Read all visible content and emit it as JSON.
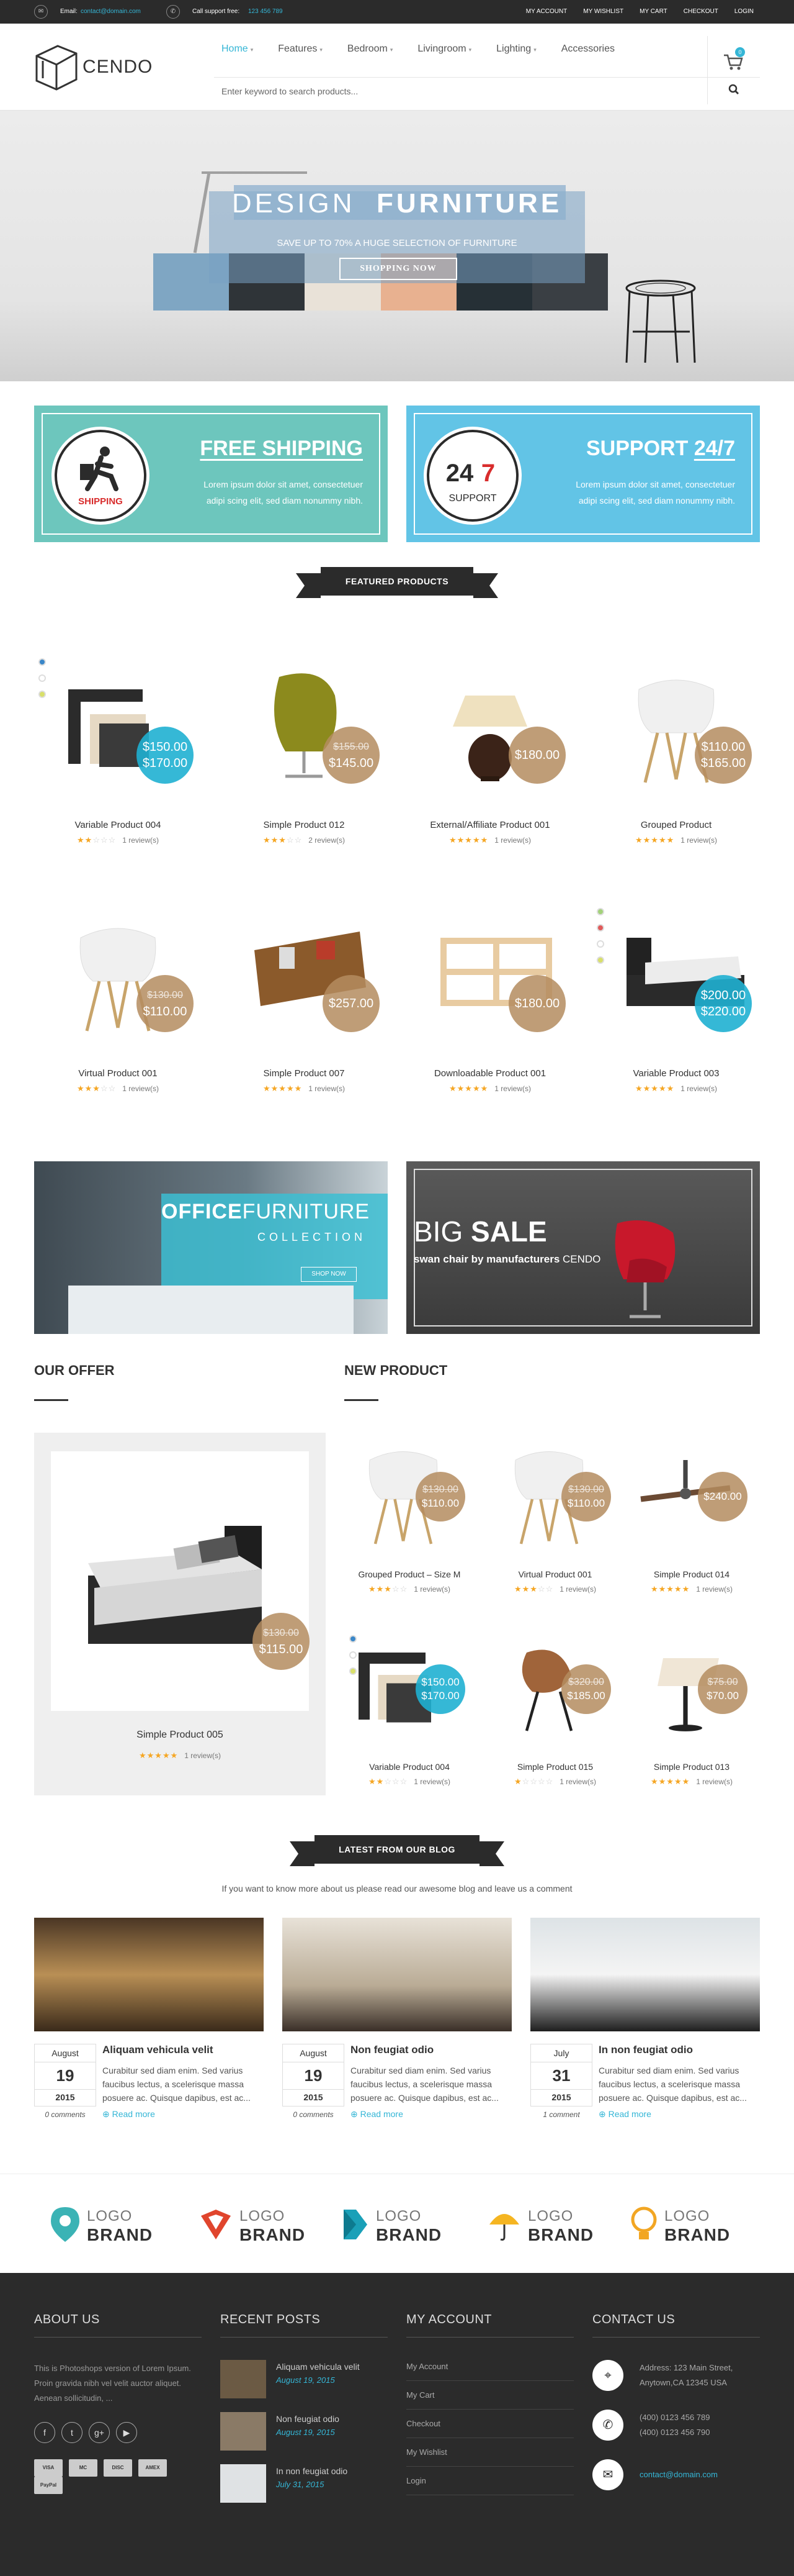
{
  "topbar": {
    "email_label": "Email:",
    "email": "contact@domain.com",
    "phone_label": "Call support free:",
    "phone": "123 456 789",
    "menu": [
      "MY ACCOUNT",
      "MY WISHLIST",
      "MY CART",
      "CHECKOUT",
      "LOGIN"
    ]
  },
  "header": {
    "logo": "CENDO",
    "nav": [
      {
        "label": "Home",
        "dd": true
      },
      {
        "label": "Features",
        "dd": true
      },
      {
        "label": "Bedroom",
        "dd": true
      },
      {
        "label": "Livingroom",
        "dd": true
      },
      {
        "label": "Lighting",
        "dd": true
      },
      {
        "label": "Accessories",
        "dd": false
      }
    ],
    "cart_count": "0",
    "search_placeholder": "Enter keyword to search products..."
  },
  "hero": {
    "title_light": "DESIGN",
    "title_bold": "FURNITURE",
    "subtitle": "SAVE UP TO 70% A HUGE SELECTION OF FURNITURE",
    "button": "SHOPPING NOW"
  },
  "features": [
    {
      "title": "FREE SHIPPING",
      "icon_label": "SHIPPING",
      "text": "Lorem ipsum dolor sit amet, consectetuer adipi scing elit, sed diam nonummy nibh.",
      "color": "#6dc6bd"
    },
    {
      "title_a": "SUPPORT",
      "title_b": "24/7",
      "icon_a": "24",
      "icon_b": "7",
      "icon_label": "SUPPORT",
      "text": "Lorem ipsum dolor sit amet, consectetuer adipi scing elit, sed diam nonummy nibh.",
      "color": "#62c4e6"
    }
  ],
  "featured_title": "FEATURED PRODUCTS",
  "products": [
    {
      "name": "Variable Product 004",
      "reviews": "1 review(s)",
      "stars": 2,
      "p1": "$150.00",
      "p2": "$170.00",
      "blue": true
    },
    {
      "name": "Simple Product 012",
      "reviews": "2 review(s)",
      "stars": 3,
      "p1": "$155.00",
      "p2": "$145.00",
      "old": true,
      "blue": false
    },
    {
      "name": "External/Affiliate Product 001",
      "reviews": "1 review(s)",
      "stars": 5,
      "p1": "",
      "p2": "$180.00",
      "blue": false
    },
    {
      "name": "Grouped Product",
      "reviews": "1 review(s)",
      "stars": 5,
      "p1": "$110.00",
      "p2": "$165.00",
      "blue": false
    },
    {
      "name": "Virtual Product 001",
      "reviews": "1 review(s)",
      "stars": 3,
      "p1": "$130.00",
      "p2": "$110.00",
      "old": true,
      "blue": false
    },
    {
      "name": "Simple Product 007",
      "reviews": "1 review(s)",
      "stars": 5,
      "p1": "",
      "p2": "$257.00",
      "blue": false
    },
    {
      "name": "Downloadable Product 001",
      "reviews": "1 review(s)",
      "stars": 5,
      "p1": "",
      "p2": "$180.00",
      "blue": false
    },
    {
      "name": "Variable Product 003",
      "reviews": "1 review(s)",
      "stars": 5,
      "p1": "$200.00",
      "p2": "$220.00",
      "blue": true
    }
  ],
  "banners": {
    "office_a": "OFFICE",
    "office_b": "FURNITURE",
    "office_c": "COLLECTION",
    "office_btn": "SHOP NOW",
    "sale_a": "BIG",
    "sale_b": "SALE",
    "sale_c": "swan chair by",
    "sale_d": "manufacturers",
    "sale_e": "CENDO"
  },
  "offer": {
    "title": "OUR OFFER",
    "name": "Simple Product 005",
    "reviews": "1 review(s)",
    "p1": "$130.00",
    "p2": "$115.00"
  },
  "newprod": {
    "title": "NEW PRODUCT",
    "items": [
      {
        "name": "Grouped Product – Size M",
        "reviews": "1 review(s)",
        "stars": 3,
        "p1": "$130.00",
        "p2": "$110.00",
        "blue": false
      },
      {
        "name": "Virtual Product 001",
        "reviews": "1 review(s)",
        "stars": 3,
        "p1": "$130.00",
        "p2": "$110.00",
        "blue": false
      },
      {
        "name": "Simple Product 014",
        "reviews": "1 review(s)",
        "stars": 5,
        "p1": "",
        "p2": "$240.00",
        "blue": false
      },
      {
        "name": "Variable Product 004",
        "reviews": "1 review(s)",
        "stars": 2,
        "p1": "$150.00",
        "p2": "$170.00",
        "blue": true
      },
      {
        "name": "Simple Product 015",
        "reviews": "1 review(s)",
        "stars": 1,
        "p1": "$320.00",
        "p2": "$185.00",
        "blue": false
      },
      {
        "name": "Simple Product 013",
        "reviews": "1 review(s)",
        "stars": 5,
        "p1": "$75.00",
        "p2": "$70.00",
        "blue": false
      }
    ]
  },
  "blog": {
    "title": "LATEST FROM OUR BLOG",
    "intro": "If you want to know more about us please read our awesome blog and leave us a comment",
    "posts": [
      {
        "month": "August",
        "day": "19",
        "year": "2015",
        "comments": "0 comments",
        "title": "Aliquam vehicula velit",
        "excerpt": "Curabitur sed diam enim. Sed varius faucibus lectus, a scelerisque massa posuere ac. Quisque dapibus, est ac...",
        "more": "Read more"
      },
      {
        "month": "August",
        "day": "19",
        "year": "2015",
        "comments": "0 comments",
        "title": "Non feugiat odio",
        "excerpt": "Curabitur sed diam enim. Sed varius faucibus lectus, a scelerisque massa posuere ac. Quisque dapibus, est ac...",
        "more": "Read more"
      },
      {
        "month": "July",
        "day": "31",
        "year": "2015",
        "comments": "1 comment",
        "title": "In non feugiat odio",
        "excerpt": "Curabitur sed diam enim. Sed varius faucibus lectus, a scelerisque massa posuere ac. Quisque dapibus, est ac...",
        "more": "Read more"
      }
    ]
  },
  "brands": [
    {
      "a": "LOGO",
      "b": "BRAND",
      "color": "#3bb3b5"
    },
    {
      "a": "LOGO",
      "b": "BRAND",
      "color": "#e0452d"
    },
    {
      "a": "LOGO",
      "b": "BRAND",
      "color": "#1aa0b8"
    },
    {
      "a": "LOGO",
      "b": "BRAND",
      "color": "#f5b521"
    },
    {
      "a": "LOGO",
      "b": "BRAND",
      "color": "#f2a623"
    }
  ],
  "footer": {
    "about_title": "ABOUT US",
    "about_text": "This is Photoshops version of Lorem Ipsum. Proin gravida nibh vel velit auctor aliquet. Aenean sollicitudin, ...",
    "social": [
      "f",
      "t",
      "g+",
      "▶"
    ],
    "payments": [
      "VISA",
      "MC",
      "DISC",
      "AMEX",
      "PayPal"
    ],
    "recent_title": "RECENT POSTS",
    "recent": [
      {
        "title": "Aliquam vehicula velit",
        "date": "August 19, 2015"
      },
      {
        "title": "Non feugiat odio",
        "date": "August 19, 2015"
      },
      {
        "title": "In non feugiat odio",
        "date": "July 31, 2015"
      }
    ],
    "account_title": "MY ACCOUNT",
    "account": [
      "My Account",
      "My Cart",
      "Checkout",
      "My Wishlist",
      "Login"
    ],
    "contact_title": "CONTACT US",
    "address_label": "Address:",
    "address_1": "123 Main Street,",
    "address_2": "Anytown,CA 12345 USA",
    "phone_1": "(400) 0123 456 789",
    "phone_2": "(400) 0123 456 790",
    "email": "contact@domain.com"
  },
  "colors": {
    "accent": "#35b6d6",
    "dark": "#2b2b2b",
    "price": "#b48c5f"
  }
}
